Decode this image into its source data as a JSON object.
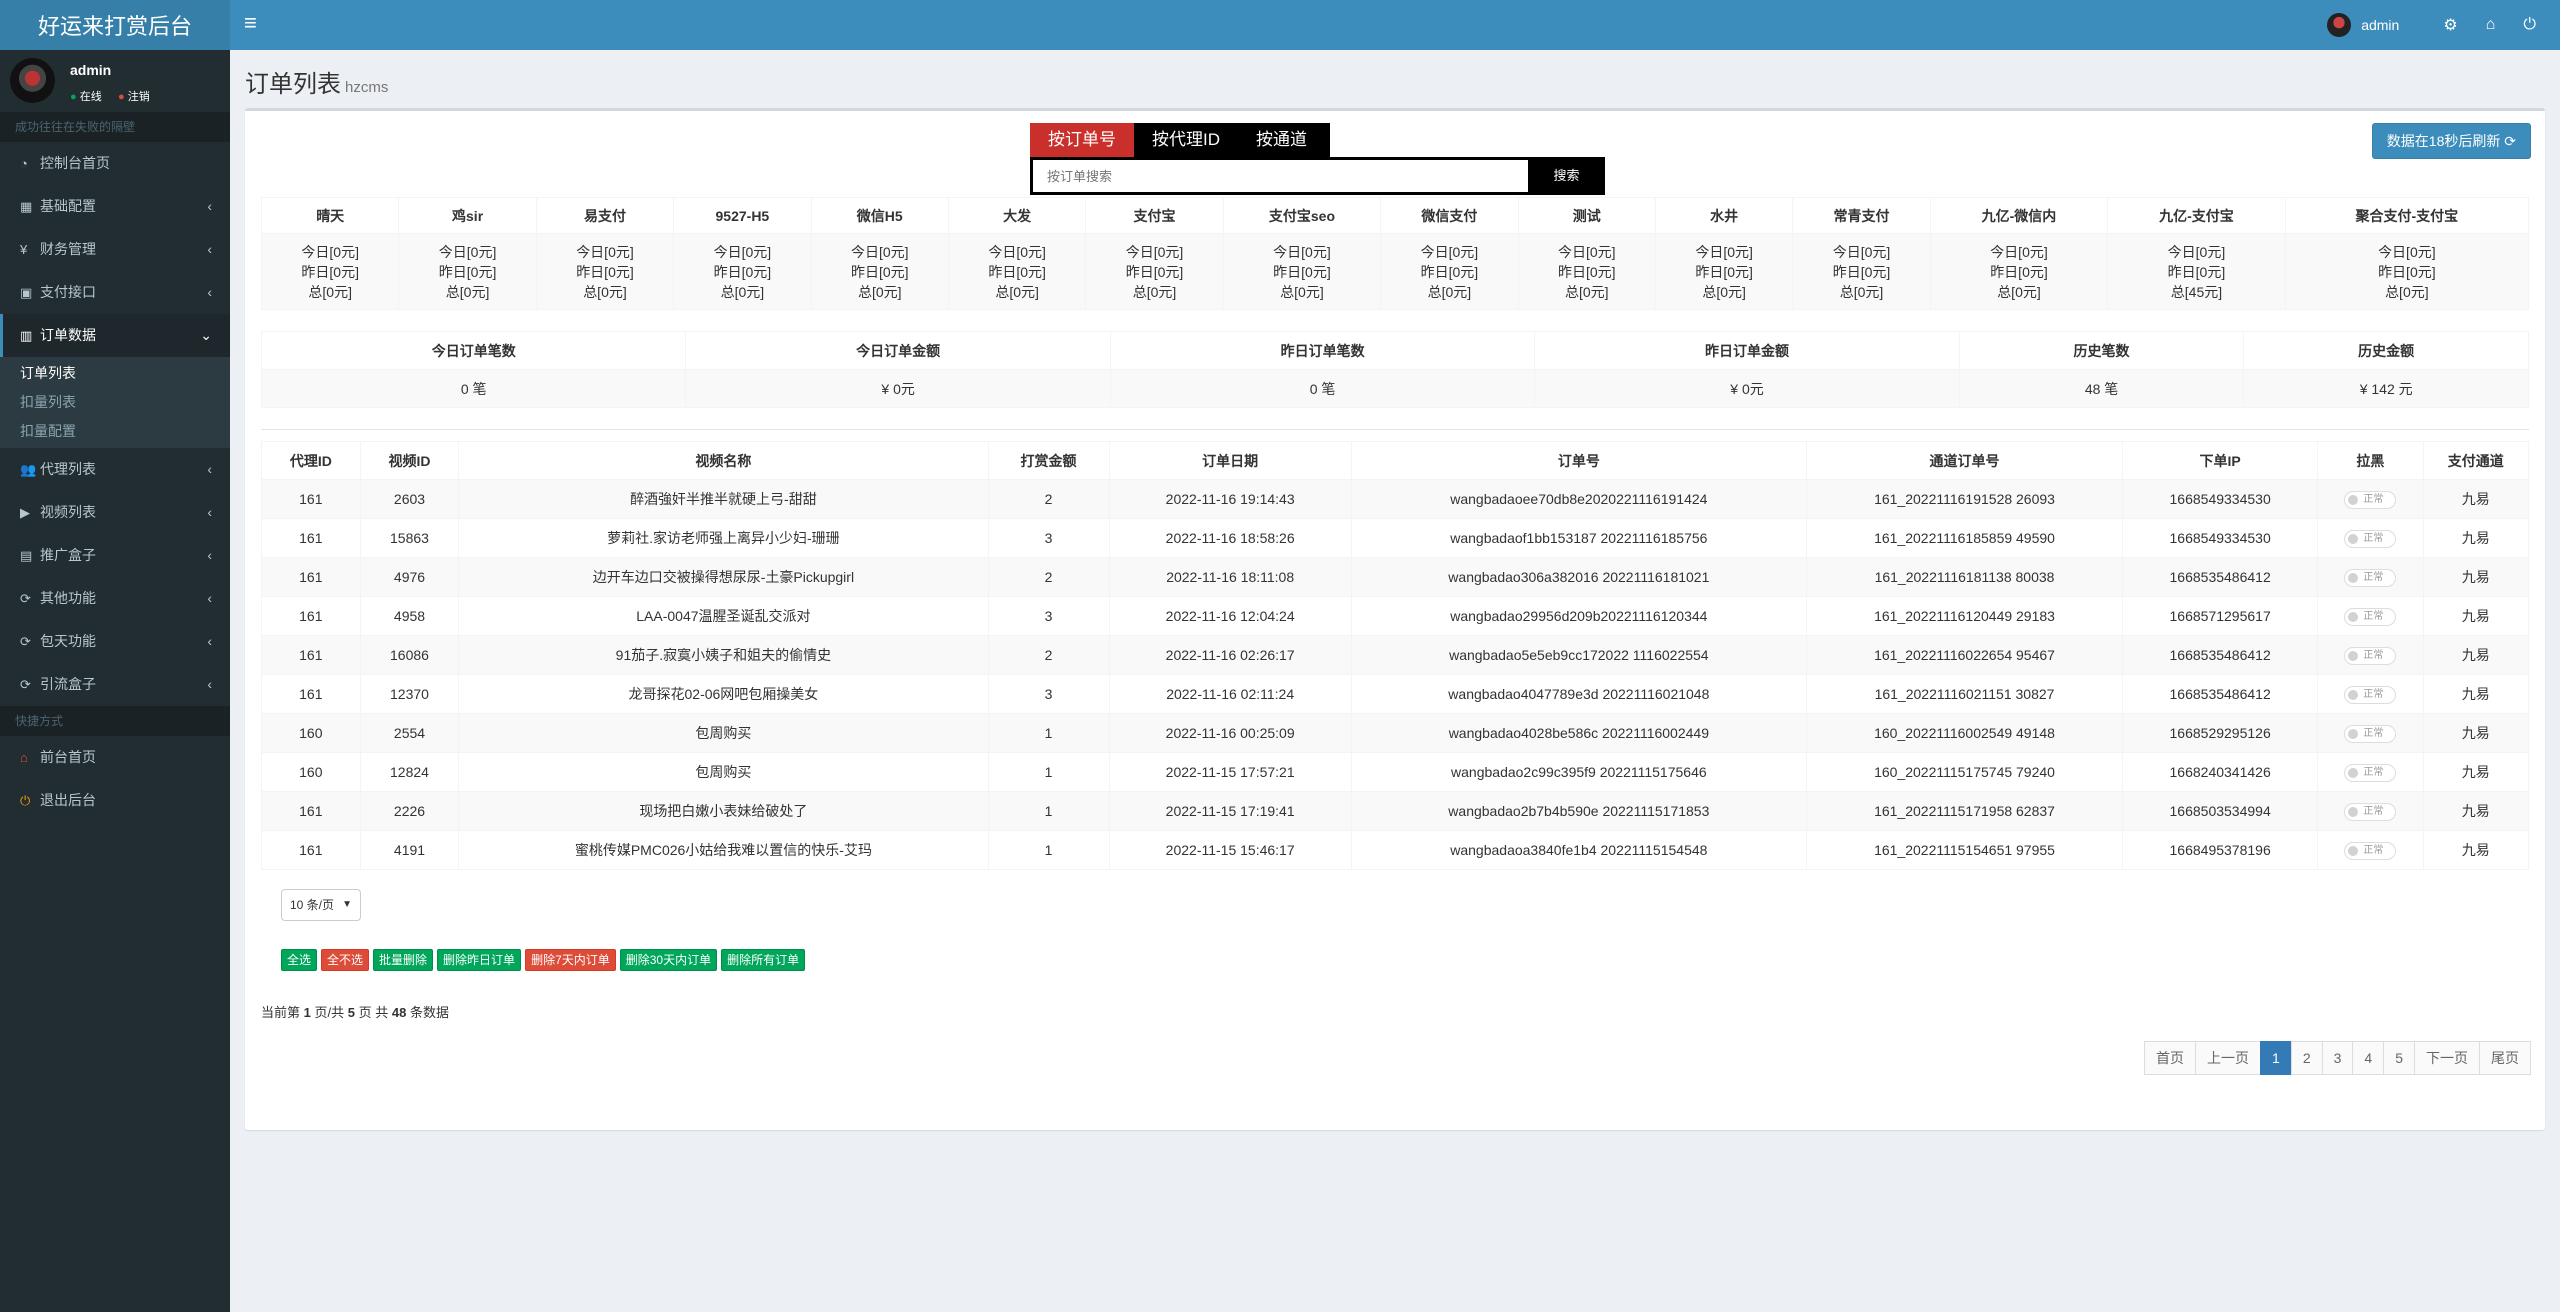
{
  "app": {
    "title": "好运来打赏后台"
  },
  "navbar": {
    "username": "admin"
  },
  "sidebar": {
    "username": "admin",
    "status_online": "在线",
    "status_logout": "注销",
    "section_main": "成功往往在失败的隔壁",
    "items": [
      {
        "label": "控制台首页",
        "icon": "dashboard-icon"
      },
      {
        "label": "基础配置",
        "icon": "grid-icon"
      },
      {
        "label": "财务管理",
        "icon": "yen-icon"
      },
      {
        "label": "支付接口",
        "icon": "card-icon"
      },
      {
        "label": "订单数据",
        "icon": "chart-icon"
      },
      {
        "label": "代理列表",
        "icon": "users-icon"
      },
      {
        "label": "视频列表",
        "icon": "video-icon"
      },
      {
        "label": "推广盒子",
        "icon": "table-icon"
      },
      {
        "label": "其他功能",
        "icon": "refresh-icon"
      },
      {
        "label": "包天功能",
        "icon": "refresh-icon"
      },
      {
        "label": "引流盒子",
        "icon": "refresh-icon"
      }
    ],
    "submenu": [
      "订单列表",
      "扣量列表",
      "扣量配置"
    ],
    "section_quick": "快捷方式",
    "quick": [
      {
        "label": "前台首页",
        "icon": "home-icon"
      },
      {
        "label": "退出后台",
        "icon": "power-icon"
      }
    ]
  },
  "page": {
    "title": "订单列表",
    "subtitle": "hzcms"
  },
  "search": {
    "tabs": [
      "按订单号",
      "按代理ID",
      "按通道"
    ],
    "placeholder": "按订单搜索",
    "button": "搜索",
    "refresh": "数据在18秒后刷新"
  },
  "channels": {
    "headers": [
      "晴天",
      "鸡sir",
      "易支付",
      "9527-H5",
      "微信H5",
      "大发",
      "支付宝",
      "支付宝seo",
      "微信支付",
      "测试",
      "水井",
      "常青支付",
      "九亿-微信内",
      "九亿-支付宝",
      "聚合支付-支付宝"
    ],
    "today": [
      "今日[0元]",
      "今日[0元]",
      "今日[0元]",
      "今日[0元]",
      "今日[0元]",
      "今日[0元]",
      "今日[0元]",
      "今日[0元]",
      "今日[0元]",
      "今日[0元]",
      "今日[0元]",
      "今日[0元]",
      "今日[0元]",
      "今日[0元]",
      "今日[0元]"
    ],
    "yesterday": [
      "昨日[0元]",
      "昨日[0元]",
      "昨日[0元]",
      "昨日[0元]",
      "昨日[0元]",
      "昨日[0元]",
      "昨日[0元]",
      "昨日[0元]",
      "昨日[0元]",
      "昨日[0元]",
      "昨日[0元]",
      "昨日[0元]",
      "昨日[0元]",
      "昨日[0元]",
      "昨日[0元]"
    ],
    "total": [
      "总[0元]",
      "总[0元]",
      "总[0元]",
      "总[0元]",
      "总[0元]",
      "总[0元]",
      "总[0元]",
      "总[0元]",
      "总[0元]",
      "总[0元]",
      "总[0元]",
      "总[0元]",
      "总[0元]",
      "总[45元]",
      "总[0元]"
    ]
  },
  "summary": {
    "headers": [
      "今日订单笔数",
      "今日订单金额",
      "昨日订单笔数",
      "昨日订单金额",
      "历史笔数",
      "历史金额"
    ],
    "values": [
      "0 笔",
      "¥ 0元",
      "0 笔",
      "¥ 0元",
      "48 笔",
      "¥ 142 元"
    ]
  },
  "orders": {
    "headers": [
      "代理ID",
      "视频ID",
      "视频名称",
      "打赏金额",
      "订单日期",
      "订单号",
      "通道订单号",
      "下单IP",
      "拉黑",
      "支付通道"
    ],
    "toggle_label": "正常",
    "rows": [
      [
        "161",
        "2603",
        "醉酒強奸半推半就硬上弓-甜甜",
        "2",
        "2022-11-16 19:14:43",
        "wangbadaoee70db8e2020221116191424",
        "161_20221116191528 26093",
        "1668549334530",
        "九易"
      ],
      [
        "161",
        "15863",
        "萝莉社.家访老师强上离异小少妇-珊珊",
        "3",
        "2022-11-16 18:58:26",
        "wangbadaof1bb153187 20221116185756",
        "161_20221116185859 49590",
        "1668549334530",
        "九易"
      ],
      [
        "161",
        "4976",
        "边开车边口交被操得想尿尿-土豪Pickupgirl",
        "2",
        "2022-11-16 18:11:08",
        "wangbadao306a382016 20221116181021",
        "161_20221116181138 80038",
        "1668535486412",
        "九易"
      ],
      [
        "161",
        "4958",
        "LAA-0047温腥圣诞乱交派对",
        "3",
        "2022-11-16 12:04:24",
        "wangbadao29956d209b20221116120344",
        "161_20221116120449 29183",
        "1668571295617",
        "九易"
      ],
      [
        "161",
        "16086",
        "91茄子.寂寞小姨子和姐夫的偷情史",
        "2",
        "2022-11-16 02:26:17",
        "wangbadao5e5eb9cc172022 1116022554",
        "161_20221116022654 95467",
        "1668535486412",
        "九易"
      ],
      [
        "161",
        "12370",
        "龙哥探花02-06网吧包厢操美女",
        "3",
        "2022-11-16 02:11:24",
        "wangbadao4047789e3d 20221116021048",
        "161_20221116021151 30827",
        "1668535486412",
        "九易"
      ],
      [
        "160",
        "2554",
        "包周购买",
        "1",
        "2022-11-16 00:25:09",
        "wangbadao4028be586c 20221116002449",
        "160_20221116002549 49148",
        "1668529295126",
        "九易"
      ],
      [
        "160",
        "12824",
        "包周购买",
        "1",
        "2022-11-15 17:57:21",
        "wangbadao2c99c395f9 20221115175646",
        "160_20221115175745 79240",
        "1668240341426",
        "九易"
      ],
      [
        "161",
        "2226",
        "现场把白嫩小表妹给破处了",
        "1",
        "2022-11-15 17:19:41",
        "wangbadao2b7b4b590e 20221115171853",
        "161_20221115171958 62837",
        "1668503534994",
        "九易"
      ],
      [
        "161",
        "4191",
        "蜜桃传媒PMC026小姑给我难以置信的快乐-艾玛",
        "1",
        "2022-11-15 15:46:17",
        "wangbadaoa3840fe1b4 20221115154548",
        "161_20221115154651 97955",
        "1668495378196",
        "九易"
      ]
    ]
  },
  "footer": {
    "per_page": "10 条/页",
    "actions": [
      {
        "label": "全选",
        "color": "green"
      },
      {
        "label": "全不选",
        "color": "red"
      },
      {
        "label": "批量删除",
        "color": "green"
      },
      {
        "label": "删除昨日订单",
        "color": "green"
      },
      {
        "label": "删除7天内订单",
        "color": "red"
      },
      {
        "label": "删除30天内订单",
        "color": "green"
      },
      {
        "label": "删除所有订单",
        "color": "green"
      }
    ],
    "page_info_prefix": "当前第",
    "current_page": "1",
    "page_info_mid": "页/共",
    "total_pages": "5",
    "page_info_mid2": "页 共",
    "total_rows": "48",
    "page_info_suffix": "条数据",
    "pager": [
      "首页",
      "上一页",
      "1",
      "2",
      "3",
      "4",
      "5",
      "下一页",
      "尾页"
    ]
  },
  "colors": {
    "accent": "#3c8dbc",
    "sidebar": "#222d32",
    "danger": "#c9302c",
    "success": "#00a65a"
  }
}
